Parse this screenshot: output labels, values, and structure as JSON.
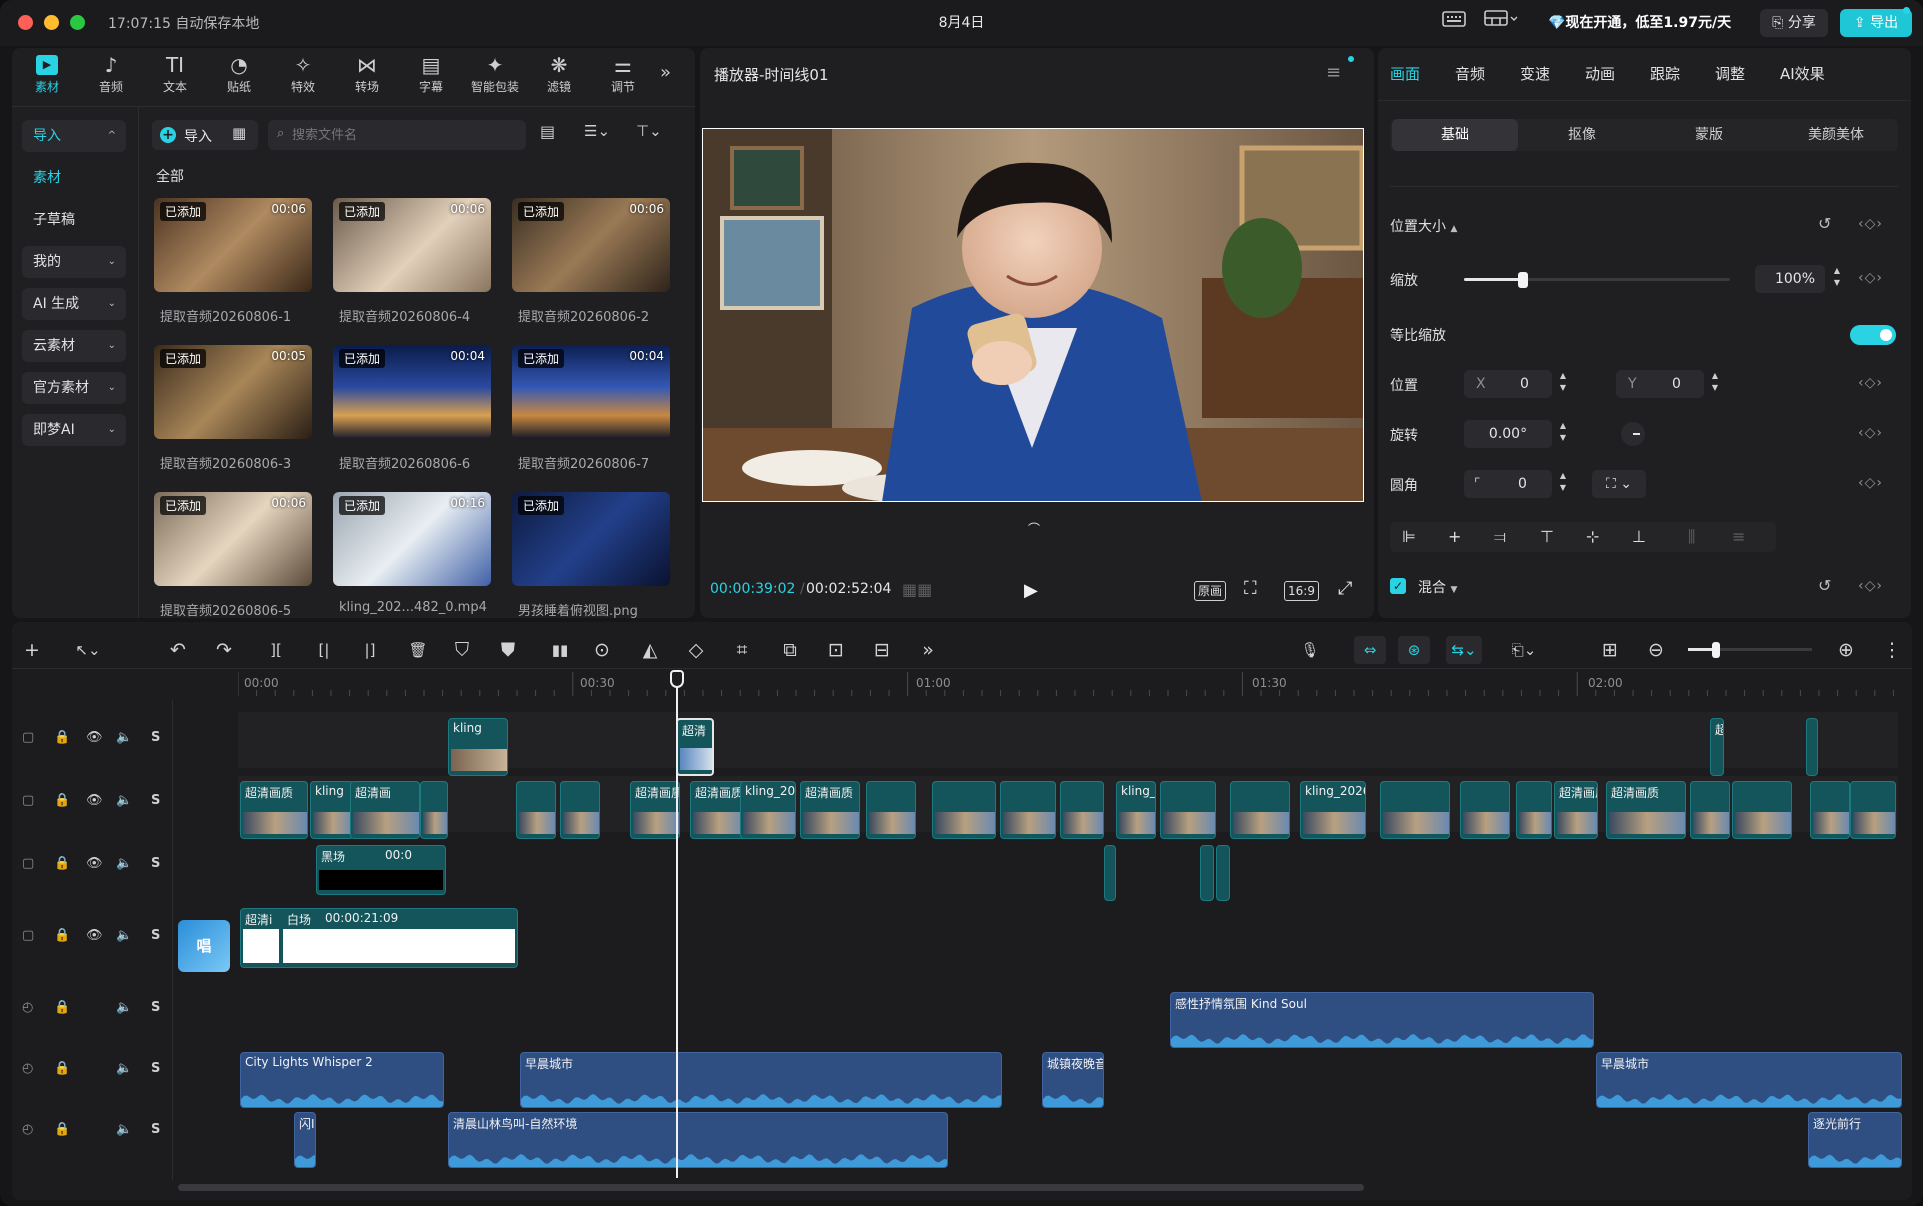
{
  "titlebar": {
    "time_status": "17:07:15 自动保存本地",
    "date": "8月4日",
    "promo": "💎现在开通，低至1.97元/天",
    "share_label": "分享",
    "export_label": "导出"
  },
  "toolbar": {
    "tabs": [
      {
        "label": "素材",
        "icon": "media-icon"
      },
      {
        "label": "音频",
        "icon": "audio-icon"
      },
      {
        "label": "文本",
        "icon": "text-icon"
      },
      {
        "label": "贴纸",
        "icon": "sticker-icon"
      },
      {
        "label": "特效",
        "icon": "effects-icon"
      },
      {
        "label": "转场",
        "icon": "transition-icon"
      },
      {
        "label": "字幕",
        "icon": "subtitle-icon"
      },
      {
        "label": "智能包装",
        "icon": "smart-pack-icon"
      },
      {
        "label": "滤镜",
        "icon": "filter-icon"
      },
      {
        "label": "调节",
        "icon": "adjust-icon"
      }
    ]
  },
  "sidebar": {
    "items": [
      {
        "label": "导入"
      },
      {
        "label": "素材"
      },
      {
        "label": "子草稿"
      },
      {
        "label": "我的"
      },
      {
        "label": "AI 生成"
      },
      {
        "label": "云素材"
      },
      {
        "label": "官方素材"
      },
      {
        "label": "即梦AI"
      }
    ]
  },
  "media": {
    "import_label": "导入",
    "search_placeholder": "搜索文件名",
    "section_label": "全部",
    "items": [
      {
        "badge": "已添加",
        "duration": "00:06",
        "name": "提取音频20260806-1"
      },
      {
        "badge": "已添加",
        "duration": "00:06",
        "name": "提取音频20260806-4"
      },
      {
        "badge": "已添加",
        "duration": "00:06",
        "name": "提取音频20260806-2"
      },
      {
        "badge": "已添加",
        "duration": "00:05",
        "name": "提取音频20260806-3"
      },
      {
        "badge": "已添加",
        "duration": "00:04",
        "name": "提取音频20260806-6"
      },
      {
        "badge": "已添加",
        "duration": "00:04",
        "name": "提取音频20260806-7"
      },
      {
        "badge": "已添加",
        "duration": "00:06",
        "name": "提取音频20260806-5"
      },
      {
        "badge": "已添加",
        "duration": "00:16",
        "name": "kling_202...482_0.mp4"
      },
      {
        "badge": "已添加",
        "duration": "",
        "name": "男孩睡着俯视图.png"
      }
    ]
  },
  "player": {
    "title": "播放器-时间线01",
    "current_time": "00:00:39:02",
    "total_time": "00:02:52:04",
    "original_label": "原画",
    "ratio_label": "16:9"
  },
  "props": {
    "tabs": [
      "画面",
      "音频",
      "变速",
      "动画",
      "跟踪",
      "调整",
      "AI效果"
    ],
    "sub_tabs": [
      "基础",
      "抠像",
      "蒙版",
      "美颜美体"
    ],
    "section_title": "位置大小",
    "scale_label": "缩放",
    "scale_value": "100%",
    "scale_level": 0.22,
    "uniform_label": "等比缩放",
    "position_label": "位置",
    "pos_x_label": "X",
    "pos_x": "0",
    "pos_y_label": "Y",
    "pos_y": "0",
    "rotation_label": "旋转",
    "rotation_value": "0.00°",
    "corner_label": "圆角",
    "corner_value": "0",
    "blend_label": "混合"
  },
  "timeline": {
    "ruler": [
      "00:00",
      "00:30",
      "01:00",
      "01:30",
      "02:00"
    ],
    "track_letter": "S",
    "video_clips": [
      {
        "label": "kling"
      },
      {
        "label": "超清"
      },
      {
        "label": "超清画质"
      },
      {
        "label": "kling"
      },
      {
        "label": "超清画"
      },
      {
        "label": "超清画质"
      },
      {
        "label": "kling_20"
      },
      {
        "label": "超清画质"
      },
      {
        "label": "kling_"
      },
      {
        "label": "kling_20260"
      },
      {
        "label": "超清画质"
      },
      {
        "label": "黑场"
      },
      {
        "label": "00:0"
      },
      {
        "label": "超清i"
      },
      {
        "label": "白场"
      },
      {
        "label": "00:00:21:09"
      },
      {
        "label": "超"
      }
    ],
    "audio_clips": [
      {
        "label": "感性抒情氛围 Kind Soul"
      },
      {
        "label": "City Lights Whisper 2"
      },
      {
        "label": "早晨城市"
      },
      {
        "label": "城镇夜晚音"
      },
      {
        "label": "早晨城市"
      },
      {
        "label": "闪I"
      },
      {
        "label": "清晨山林鸟叫-自然环境"
      },
      {
        "label": "逐光前行"
      }
    ]
  },
  "colors": {
    "accent": "#29d3e3",
    "export": "#1ec6d6",
    "video_clip": "#13555a",
    "audio_clip": "#2f4f82"
  }
}
